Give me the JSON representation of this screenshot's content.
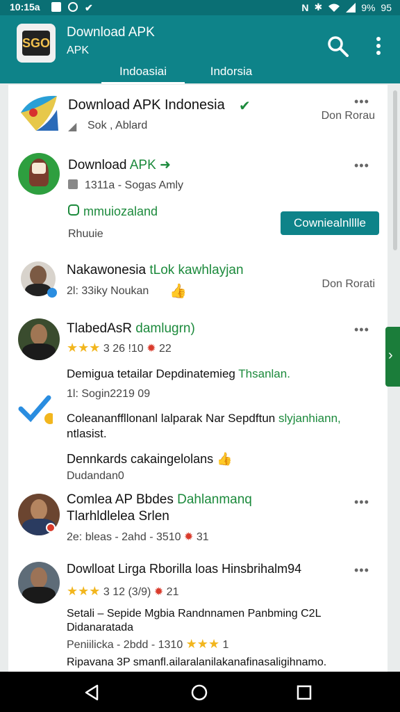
{
  "status": {
    "time": "10:15a",
    "battery": "9%",
    "clock_right": "95"
  },
  "appbar": {
    "title": "Download APK",
    "subtitle": "APK",
    "logo_text": "SGO",
    "tabs": [
      {
        "label": "Indoasiai",
        "active": true
      },
      {
        "label": "Indorsia",
        "active": false
      }
    ]
  },
  "list": [
    {
      "title": "Download APK Indonesia",
      "meta": "Sok , Ablard",
      "right": "Don Rorau",
      "more": "•••"
    },
    {
      "title": "Download",
      "title_green": "APK",
      "meta": "1311a - Sogas Amly",
      "sub": "mmuiozaland",
      "sub2": "Rhuuie",
      "button": "Cowniealnlllle",
      "more": "•••"
    },
    {
      "title": "Nakawonesia",
      "title_green": "tLok kawhlayjan",
      "meta": "2l: 33iky Noukan",
      "right": "Don Rorati"
    },
    {
      "title": "TlabedAsR",
      "title_green": "damlugrn)",
      "meta_after_stars": "3 26 !10",
      "count": "22",
      "body1": "Demigua tetailar Depdinatemieg",
      "body1_green": "Thsanlan.",
      "meta2": "1l: Sogin2219 09",
      "body2": "Coleananffllonanl lalparak Nar Sepdftun",
      "body2_green": "slyjanhiann,",
      "body2b": "ntlasist.",
      "more": "•••"
    },
    {
      "title": "Dennkards cakaingelolans",
      "meta": "Dudandan0"
    },
    {
      "title": "Comlea AP Bbdes",
      "title_green": "Dahlanmanq",
      "title2": "Tlarhldlelea Srlen",
      "meta": "2e: bleas - 2ahd - 3510",
      "count": "31",
      "more": "•••"
    },
    {
      "title": "Dowlloat Lirga Rborilla loas Hinsbrihalm94",
      "meta_after_stars": "3 12 (3/9)",
      "count": "21",
      "body1": "Setali – Sepide Mgbia Randnnamen Panbming C2L",
      "body1b": "Didanaratada",
      "meta2": "Peniilicka - 2bdd - 1310",
      "count2": "1",
      "body2": "Ripavana 3P smanfl.ailaralanilakanafinasaligihnamo.",
      "more": "•••"
    }
  ]
}
